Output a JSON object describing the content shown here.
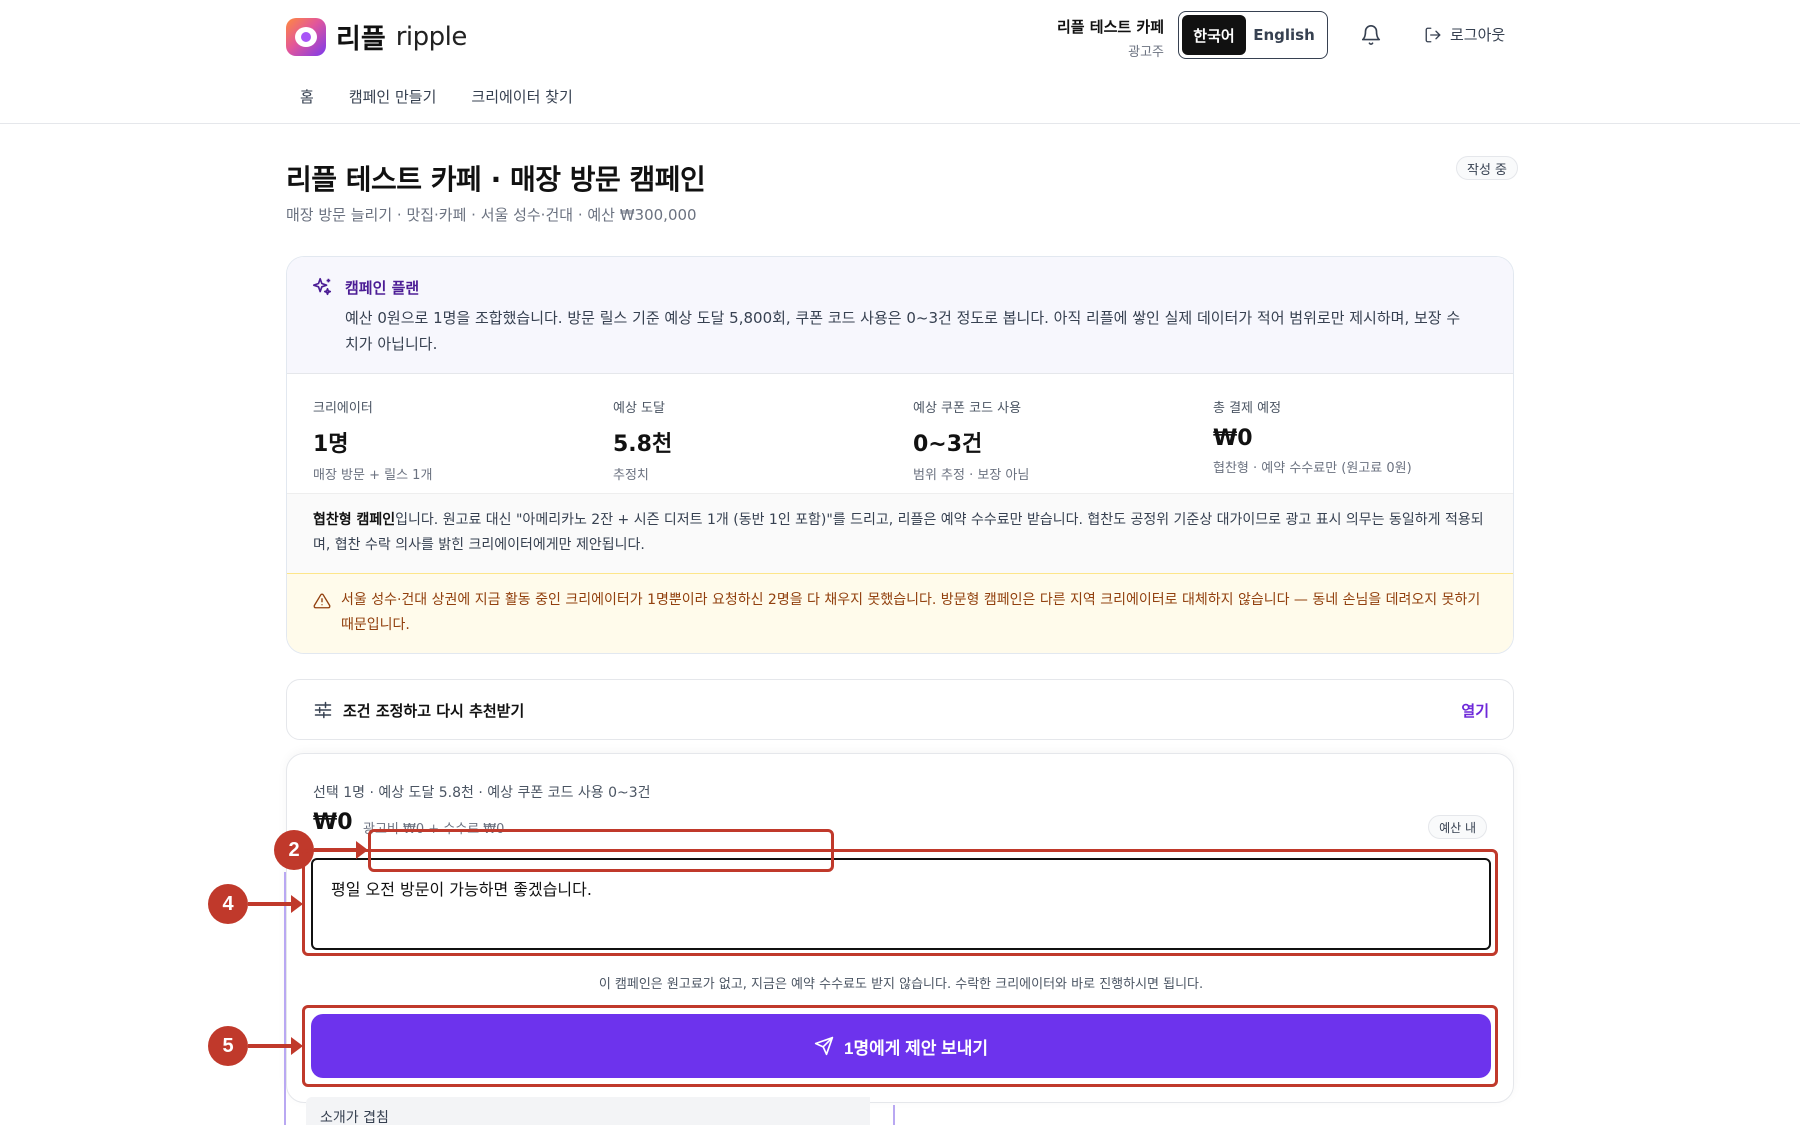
{
  "header": {
    "logo_ko": "리플",
    "logo_en": "ripple",
    "account_name": "리플 테스트 카페",
    "account_role": "광고주",
    "lang_ko": "한국어",
    "lang_en": "English",
    "logout": "로그아웃",
    "nav": [
      "홈",
      "캠페인 만들기",
      "크리에이터 찾기"
    ]
  },
  "page": {
    "title": "리플 테스트 카페 · 매장 방문 캠페인",
    "subtitle": "매장 방문 늘리기 · 맛집·카페 · 서울 성수·건대 · 예산 ₩300,000",
    "status": "작성 중"
  },
  "plan": {
    "title": "캠페인 플랜",
    "description": "예산 0원으로 1명을 조합했습니다. 방문 릴스 기준 예상 도달 5,800회, 쿠폰 코드 사용은 0~3건 정도로 봅니다. 아직 리플에 쌓인 실제 데이터가 적어 범위로만 제시하며, 보장 수치가 아닙니다.",
    "metrics": [
      {
        "label": "크리에이터",
        "value": "1명",
        "note": "매장 방문 + 릴스 1개"
      },
      {
        "label": "예상 도달",
        "value": "5.8천",
        "note": "추정치"
      },
      {
        "label": "예상 쿠폰 코드 사용",
        "value": "0~3건",
        "note": "범위 추정 · 보장 아님"
      },
      {
        "label": "총 결제 예정",
        "value": "₩0",
        "note": "협찬형 · 예약 수수료만 (원고료 0원)"
      }
    ],
    "sponsor_bold": "협찬형 캠페인",
    "sponsor_rest": "입니다. 원고료 대신 \"아메리카노 2잔 + 시즌 디저트 1개 (동반 1인 포함)\"를 드리고, 리플은 예약 수수료만 받습니다. 협찬도 공정위 기준상 대가이므로 광고 표시 의무는 동일하게 적용되며, 협찬 수락 의사를 밝힌 크리에이터에게만 제안됩니다.",
    "warning": "서울 성수·건대 상권에 지금 활동 중인 크리에이터가 1명뿐이라 요청하신 2명을 다 채우지 못했습니다. 방문형 캠페인은 다른 지역 크리에이터로 대체하지 않습니다 — 동네 손님을 데려오지 못하기 때문입니다."
  },
  "adjust": {
    "label": "조건 조정하고 다시 추천받기",
    "open": "열기"
  },
  "proposal": {
    "summary": "선택 1명 · 예상 도달 5.8천 · 예상 쿠폰 코드 사용 0~3건",
    "total": "₩0",
    "breakdown": "광고비 ₩0 + 수수료 ₩0",
    "budget_badge": "예산 내",
    "message": "평일 오전 방문이 가능하면 좋겠습니다.",
    "note": "이 캠페인은 원고료가 없고, 지금은 예약 수수료도 받지 않습니다. 수락한 크리에이터와 바로 진행하시면 됩니다.",
    "send_label": "1명에게 제안 보내기",
    "intro_label": "소개가 겹침"
  },
  "annotations": {
    "markers": [
      "2",
      "4",
      "5"
    ],
    "color": "#c0392b"
  },
  "colors": {
    "accent": "#6d33ed",
    "plan_title": "#4c1d95",
    "warning_text": "#92400e",
    "warning_bg": "#fffbeb"
  }
}
